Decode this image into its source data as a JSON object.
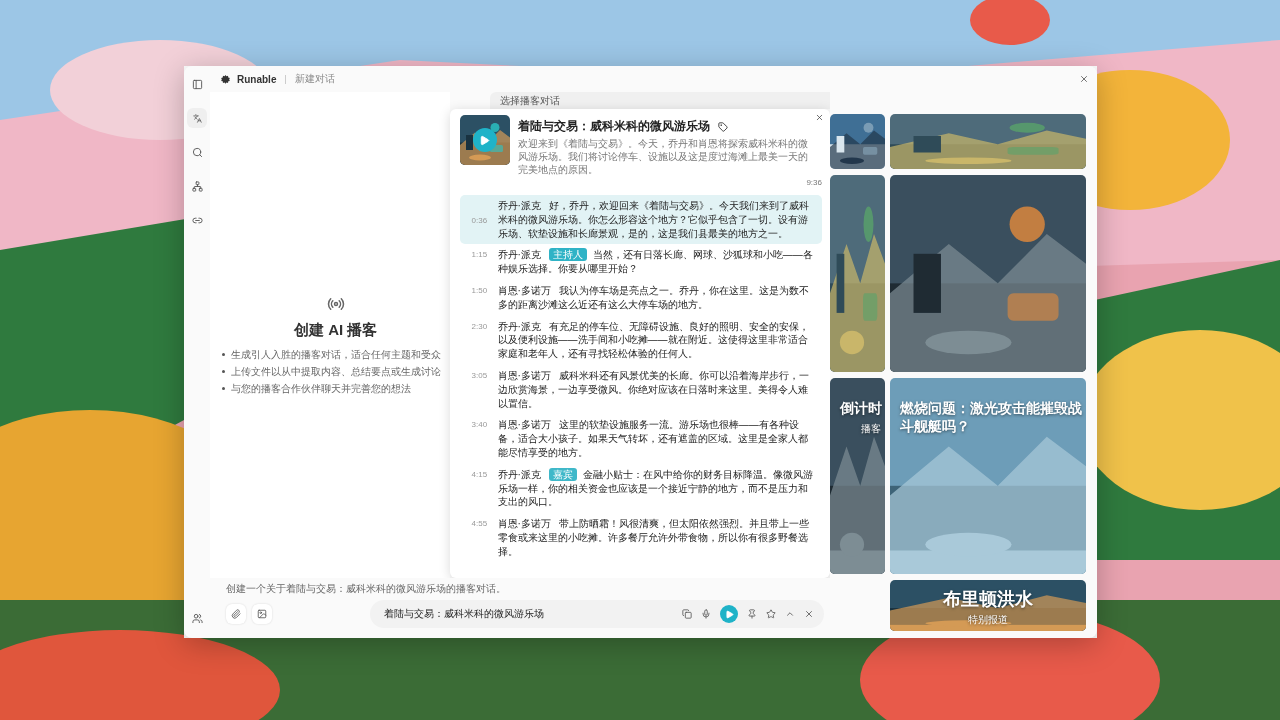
{
  "window": {
    "logo": "Runable",
    "title": "新建对话"
  },
  "welcome": {
    "title": "创建 AI 播客",
    "bullets": [
      "生成引人入胜的播客对话，适合任何主题和受众",
      "上传文件以从中提取内容、总结要点或生成讨论",
      "与您的播客合作伙伴聊天并完善您的想法"
    ]
  },
  "podcast_panel": {
    "tab": "选择播客对话",
    "cover": {
      "kind": "picture"
    },
    "title": "着陆与交易：威科米科的微风游乐场",
    "description": "欢迎来到《着陆与交易》。今天，乔丹和肖恩将探索威科米科的微风游乐场。我们将讨论停车、设施以及这是度过海滩上最美一天的完美地点的原因。",
    "duration": "9:36",
    "transcript": [
      {
        "time": "0:36",
        "speaker": "乔丹·派克",
        "text": "好，乔丹，欢迎回来《着陆与交易》。今天我们来到了威科米科的微风游乐场。你怎么形容这个地方？它似乎包含了一切。设有游乐场、软垫设施和长廊景观，是的，这是我们县最美的地方之一。",
        "selected": true
      },
      {
        "time": "1:15",
        "speaker": "乔丹·派克",
        "badge": {
          "label": "主持人",
          "color": "#2fb3c6"
        },
        "text": "当然，还有日落长廊、网球、沙狐球和小吃——各种娱乐选择。你要从哪里开始？",
        "selected": false
      },
      {
        "time": "1:50",
        "speaker": "肖恩·多诺万",
        "text": "我认为停车场是亮点之一。乔丹，你在这里。这是为数不多的距离沙滩这么近还有这么大停车场的地方。",
        "selected": false
      },
      {
        "time": "2:30",
        "speaker": "乔丹·派克",
        "text": "有充足的停车位、无障碍设施、良好的照明、安全的安保，以及便利设施——洗手间和小吃摊——就在附近。这使得这里非常适合家庭和老年人，还有寻找轻松体验的任何人。",
        "selected": false
      },
      {
        "time": "3:05",
        "speaker": "肖恩·多诺万",
        "text": "威科米科还有风景优美的长廊。你可以沿着海岸步行，一边欣赏海景，一边享受微风。你绝对应该在日落时来这里。美得令人难以置信。",
        "selected": false
      },
      {
        "time": "3:40",
        "speaker": "肖恩·多诺万",
        "text": "这里的软垫设施服务一流。游乐场也很棒——有各种设备，适合大小孩子。如果天气转坏，还有遮盖的区域。这里是全家人都能尽情享受的地方。",
        "selected": false
      },
      {
        "time": "4:15",
        "speaker": "乔丹·派克",
        "badge": {
          "label": "嘉宾",
          "color": "#3fb8c9"
        },
        "text": "金融小贴士：在风中给你的财务目标降温。像微风游乐场一样，你的相关资金也应该是一个接近宁静的地方，而不是压力和支出的风口。",
        "selected": false
      },
      {
        "time": "4:55",
        "speaker": "肖恩·多诺万",
        "text": "带上防晒霜！风很清爽，但太阳依然强烈。并且带上一些零食或来这里的小吃摊。许多餐厅允许外带食物，所以你有很多野餐选择。",
        "selected": false
      }
    ]
  },
  "gallery": {
    "column_1": [
      {
        "kind": "picture"
      },
      {
        "kind": "picture"
      },
      {
        "kind": "picture",
        "title": "倒计时",
        "subtitle": "播客"
      }
    ],
    "column_2": [
      {
        "kind": "picture"
      },
      {
        "kind": "picture"
      },
      {
        "kind": "picture",
        "title": "燃烧问题：激光攻击能摧毁战斗舰艇吗？"
      },
      {
        "kind": "picture",
        "title": "布里顿洪水",
        "subtitle": "特别报道"
      }
    ]
  },
  "composer": {
    "prompt": "创建一个关于着陆与交易：威科米科的微风游乐场的播客对话。",
    "value": "着陆与交易：威科米科的微风游乐场"
  }
}
